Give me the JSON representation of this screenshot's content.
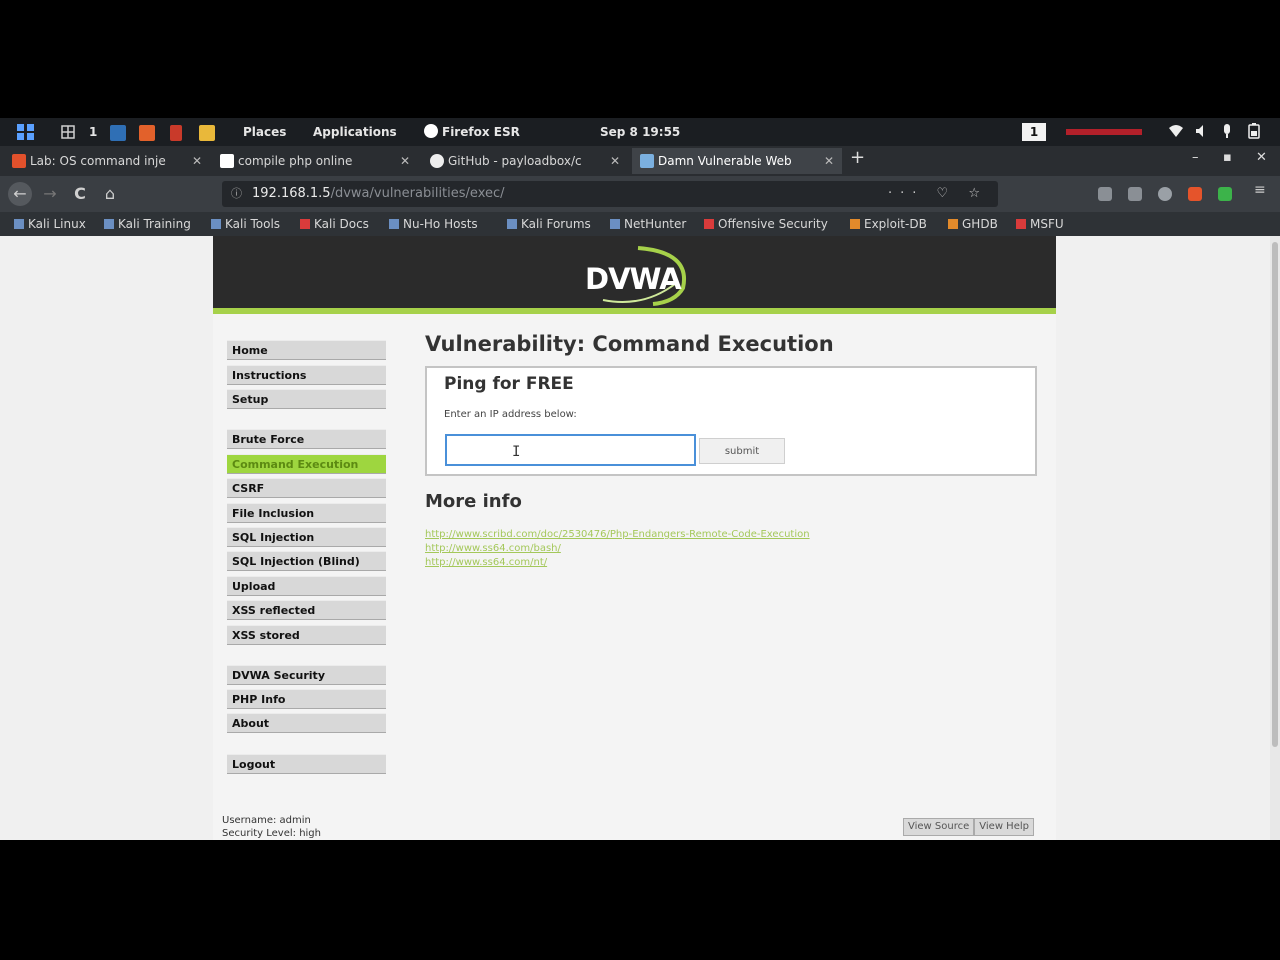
{
  "top_panel": {
    "workspace": "1",
    "places": "Places",
    "applications": "Applications",
    "active_app": "Firefox ESR",
    "clock": "Sep 8  19:55",
    "workspace_badge": "1"
  },
  "tabs": [
    {
      "title": "Lab: OS command inje",
      "active": false
    },
    {
      "title": "compile php online",
      "active": false
    },
    {
      "title": "GitHub - payloadbox/c",
      "active": false
    },
    {
      "title": "Damn Vulnerable Web",
      "active": true
    }
  ],
  "new_tab_label": "+",
  "window_controls": {
    "minimize": "–",
    "maximize": "▪",
    "close": "✕"
  },
  "nav": {
    "back": "←",
    "forward": "→",
    "reload": "C",
    "home": "⌂",
    "url_host": "192.168.1.5",
    "url_path": "/dvwa/vulnerabilities/exec/",
    "url_actions": "··· ♡ ☆"
  },
  "bookmarks": [
    {
      "label": "Kali Linux"
    },
    {
      "label": "Kali Training"
    },
    {
      "label": "Kali Tools"
    },
    {
      "label": "Kali Docs"
    },
    {
      "label": "Nu-Ho Hosts"
    },
    {
      "label": "Kali Forums"
    },
    {
      "label": "NetHunter"
    },
    {
      "label": "Offensive Security"
    },
    {
      "label": "Exploit-DB"
    },
    {
      "label": "GHDB"
    },
    {
      "label": "MSFU"
    }
  ],
  "dvwa": {
    "logo": "DVWA",
    "menu": [
      {
        "label": "Home"
      },
      {
        "label": "Instructions"
      },
      {
        "label": "Setup"
      },
      {
        "label": "Brute Force"
      },
      {
        "label": "Command Execution"
      },
      {
        "label": "CSRF"
      },
      {
        "label": "File Inclusion"
      },
      {
        "label": "SQL Injection"
      },
      {
        "label": "SQL Injection (Blind)"
      },
      {
        "label": "Upload"
      },
      {
        "label": "XSS reflected"
      },
      {
        "label": "XSS stored"
      },
      {
        "label": "DVWA Security"
      },
      {
        "label": "PHP Info"
      },
      {
        "label": "About"
      },
      {
        "label": "Logout"
      }
    ],
    "selected_menu": "Command Execution",
    "title": "Vulnerability: Command Execution",
    "ping": {
      "title": "Ping for FREE",
      "label": "Enter an IP address below:",
      "input_value": "",
      "submit": "submit"
    },
    "more_info_title": "More info",
    "links": [
      "http://www.scribd.com/doc/2530476/Php-Endangers-Remote-Code-Execution",
      "http://www.ss64.com/bash/",
      "http://www.ss64.com/nt/"
    ],
    "footer": {
      "username": "Username: admin",
      "security": "Security Level: high",
      "view_source": "View Source",
      "view_help": "View Help"
    }
  },
  "colors": {
    "dvwa_green": "#a6d14a",
    "header_dark": "#2b2b2b",
    "link": "#a4c85a"
  }
}
